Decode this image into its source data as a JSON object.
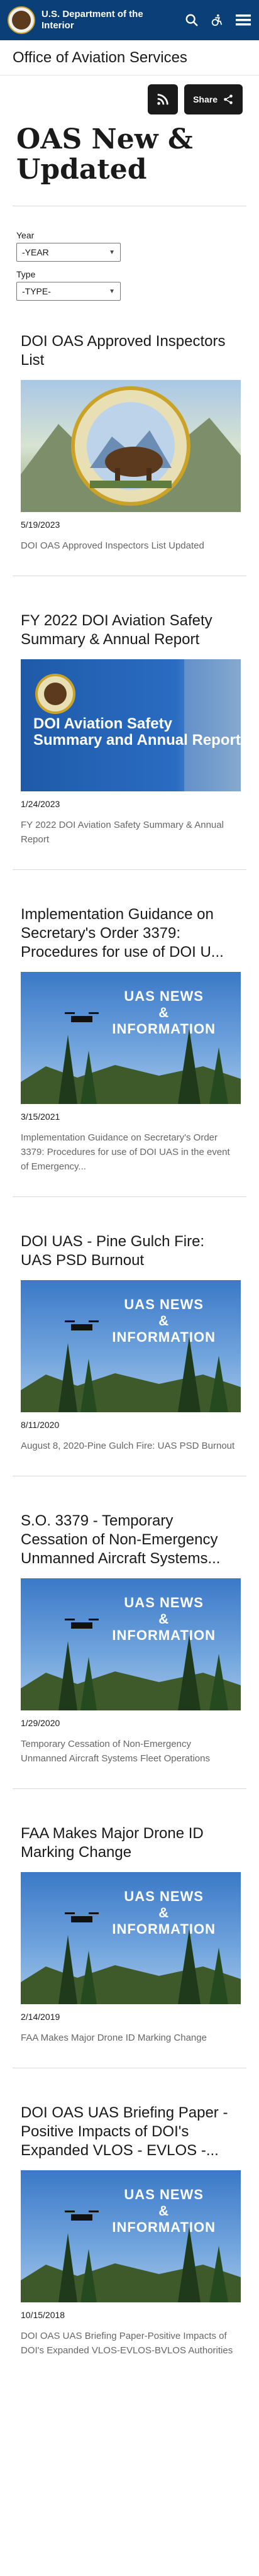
{
  "header": {
    "brand": "U.S. Department of the Interior",
    "icons": [
      "search-icon",
      "accessibility-icon",
      "menu-icon"
    ]
  },
  "office": {
    "name": "Office of Aviation Services"
  },
  "page": {
    "title": "OAS New & Updated",
    "share_label": "Share"
  },
  "filters": {
    "year_label": "Year",
    "year_value": "-YEAR",
    "type_label": "Type",
    "type_value": "-TYPE-"
  },
  "items": [
    {
      "title": "DOI OAS Approved Inspectors List",
      "image": "doi-seal",
      "date": "5/19/2023",
      "description": "DOI OAS Approved Inspectors List Updated"
    },
    {
      "title": "FY 2022 DOI Aviation Safety Summary & Annual Report",
      "image": "report-cover",
      "date": "1/24/2023",
      "description": "FY 2022 DOI Aviation Safety Summary & Annual Report",
      "image_text": "DOI Aviation Safety Summary and Annual Report"
    },
    {
      "title": "Implementation Guidance on Secretary's Order 3379: Procedures for use of DOI U...",
      "image": "uas-news",
      "date": "3/15/2021",
      "description": "Implementation Guidance on Secretary's Order 3379: Procedures for use of DOI UAS in the event of Emergency..."
    },
    {
      "title": "DOI UAS - Pine Gulch Fire: UAS PSD Burnout",
      "image": "uas-news",
      "date": "8/11/2020",
      "description": "August 8, 2020-Pine Gulch Fire: UAS PSD Burnout"
    },
    {
      "title": "S.O. 3379 - Temporary Cessation of Non-Emergency Unmanned Aircraft Systems...",
      "image": "uas-news",
      "date": "1/29/2020",
      "description": "Temporary Cessation of Non-Emergency Unmanned Aircraft Systems Fleet Operations"
    },
    {
      "title": "FAA Makes Major Drone ID Marking Change",
      "image": "uas-news",
      "date": "2/14/2019",
      "description": "FAA Makes Major Drone ID Marking Change"
    },
    {
      "title": "DOI OAS UAS Briefing Paper - Positive Impacts of DOI's Expanded VLOS - EVLOS -...",
      "image": "uas-news",
      "date": "10/15/2018",
      "description": "DOI OAS UAS Briefing Paper-Positive Impacts of DOI's Expanded VLOS-EVLOS-BVLOS Authorities"
    }
  ],
  "uas_image_text": {
    "line1": "UAS NEWS",
    "line2": "&",
    "line3": "INFORMATION"
  }
}
